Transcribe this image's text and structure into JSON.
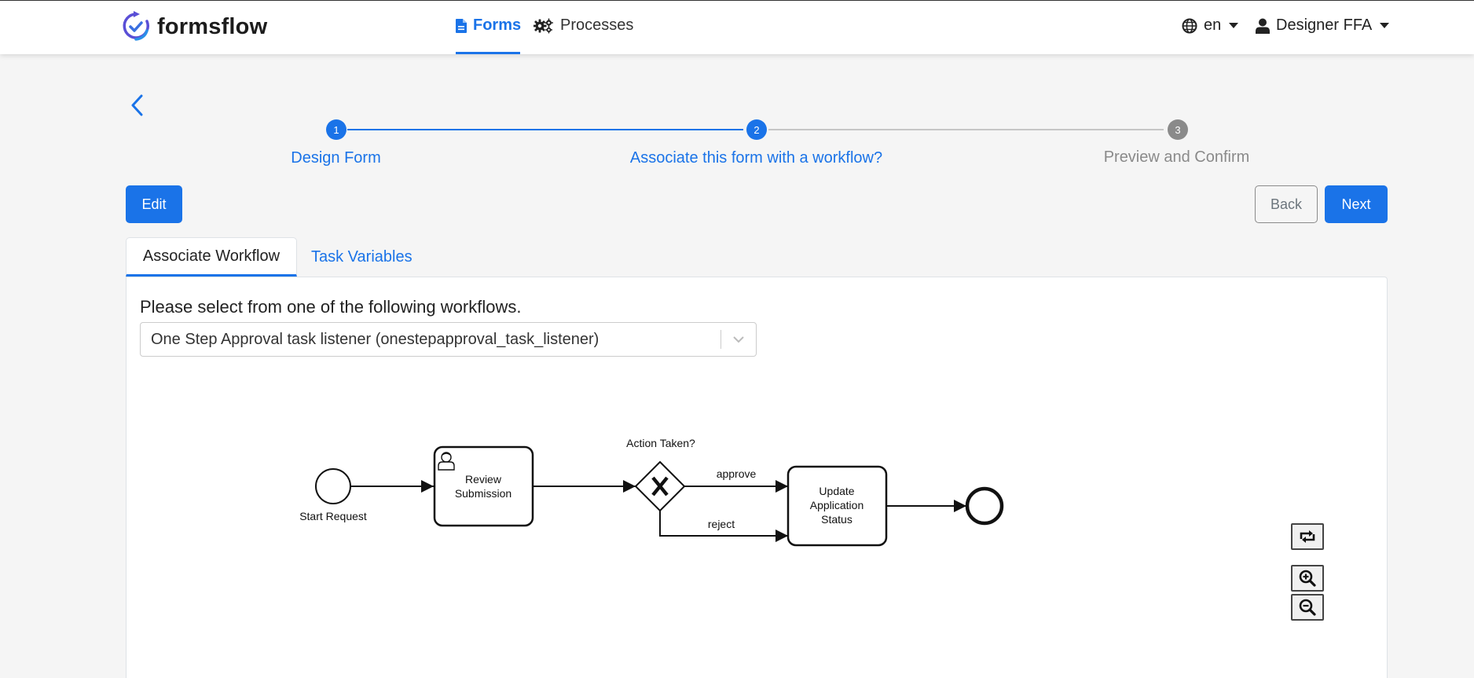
{
  "brand": {
    "name": "formsflow"
  },
  "nav": {
    "forms": "Forms",
    "processes": "Processes",
    "language": "en",
    "user": "Designer FFA"
  },
  "stepper": {
    "steps": [
      {
        "number": "1",
        "label": "Design Form",
        "state": "completed"
      },
      {
        "number": "2",
        "label": "Associate this form with a workflow?",
        "state": "active"
      },
      {
        "number": "3",
        "label": "Preview and Confirm",
        "state": "pending"
      }
    ]
  },
  "buttons": {
    "edit": "Edit",
    "back": "Back",
    "next": "Next"
  },
  "tabs": [
    {
      "label": "Associate Workflow",
      "active": true
    },
    {
      "label": "Task Variables",
      "active": false
    }
  ],
  "workflow_select": {
    "prompt": "Please select from one of the following workflows.",
    "value": "One Step Approval task listener (onestepapproval_task_listener)"
  },
  "diagram": {
    "start_event": "Start Request",
    "task_review": [
      "Review",
      "Submission"
    ],
    "gateway": "Action Taken?",
    "flow_approve": "approve",
    "flow_reject": "reject",
    "task_update": [
      "Update",
      "Application",
      "Status"
    ]
  },
  "colors": {
    "primary": "#1a73e8",
    "inactive_step": "#8a8a8a"
  }
}
